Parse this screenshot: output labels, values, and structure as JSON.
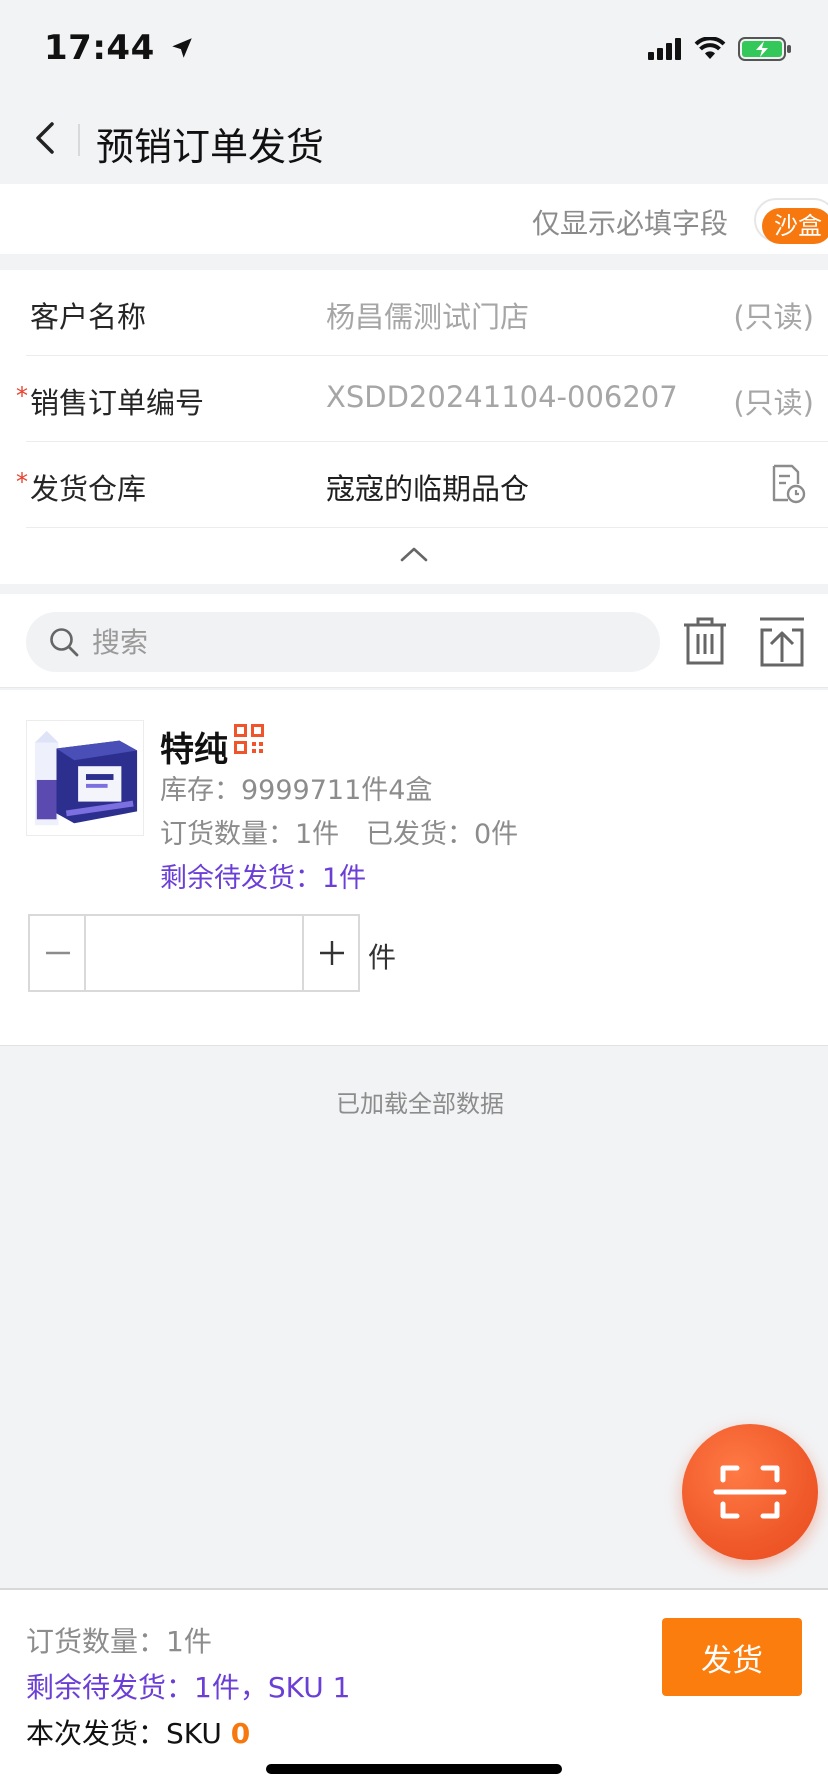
{
  "status_bar": {
    "time": "17:44"
  },
  "nav": {
    "title": "预销订单发货"
  },
  "required_filter": {
    "label": "仅显示必填字段",
    "badge": "沙盒"
  },
  "form": {
    "customer": {
      "label": "客户名称",
      "value": "杨昌儒测试门店",
      "suffix": "(只读)"
    },
    "order_no": {
      "required_mark": "*",
      "label": "销售订单编号",
      "value": "XSDD20241104-006207",
      "suffix": "(只读)"
    },
    "warehouse": {
      "required_mark": "*",
      "label": "发货仓库",
      "value": "寇寇的临期品仓"
    }
  },
  "search": {
    "placeholder": "搜索"
  },
  "product": {
    "name": "特纯",
    "stock": "库存：9999711件4盒",
    "order_qty": "订货数量：1件",
    "shipped": "已发货：0件",
    "remaining": "剩余待发货：1件",
    "unit": "件"
  },
  "list_footer": "已加载全部数据",
  "bottom": {
    "order_qty": "订货数量：1件",
    "remaining": "剩余待发货：1件，SKU 1",
    "this_ship_label": "本次发货：SKU ",
    "this_ship_count": "0",
    "ship_button": "发货"
  },
  "colors": {
    "accent_orange": "#fa7d0d",
    "remaining_purple": "#6b3fd6",
    "required_red": "#e8412f"
  },
  "icons": [
    "location-arrow-icon",
    "signal-icon",
    "wifi-icon",
    "battery-charging-icon",
    "back-chevron-icon",
    "warehouse-select-icon",
    "chevron-up-icon",
    "search-icon",
    "trash-icon",
    "upload-icon",
    "qr-code-icon",
    "minus-icon",
    "plus-icon",
    "scan-icon"
  ]
}
